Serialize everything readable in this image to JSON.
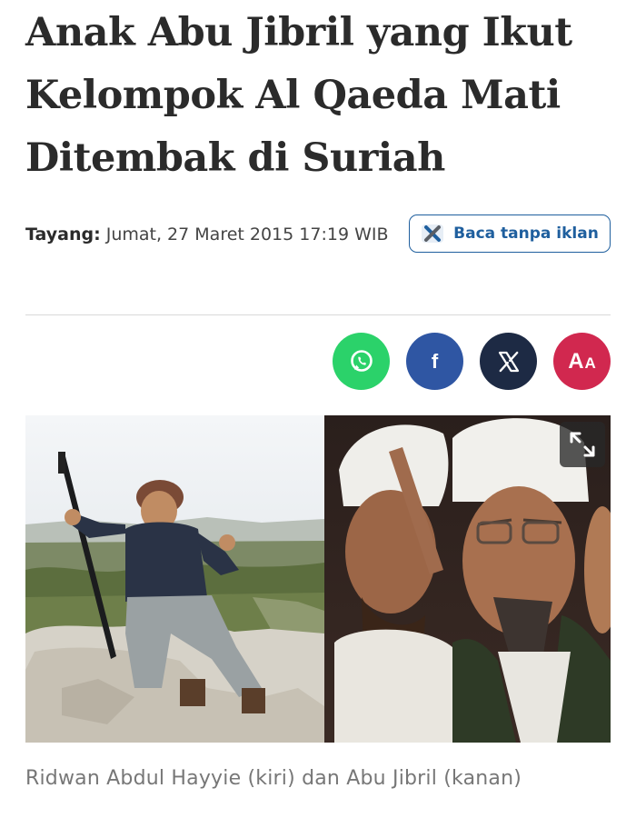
{
  "article": {
    "title": "Anak Abu Jibril yang Ikut Kelompok Al Qaeda Mati Ditembak di Suriah",
    "published_label": "Tayang:",
    "published_value": "Jumat, 27 Maret 2015 17:19 WIB",
    "ad_free_label": "Baca tanpa iklan",
    "image_caption": "Ridwan Abdul Hayyie (kiri) dan Abu Jibril (kanan)"
  },
  "share": {
    "buttons": [
      {
        "icon": "whatsapp-icon",
        "color": "#2bd26a"
      },
      {
        "icon": "facebook-icon",
        "label": "f",
        "color": "#2f56a3"
      },
      {
        "icon": "x-icon",
        "color": "#1d2a44"
      },
      {
        "icon": "font-size-icon",
        "label_big": "A",
        "label_small": "A",
        "color": "#d1284f"
      }
    ]
  },
  "colors": {
    "accent": "#1f5f9e",
    "headline": "#2b2b2b",
    "caption": "#777777"
  }
}
